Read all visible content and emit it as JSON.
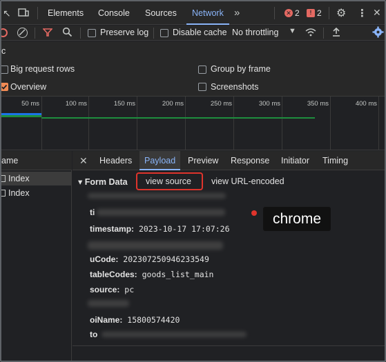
{
  "tabs": [
    {
      "label": "Elements",
      "active": false
    },
    {
      "label": "Console",
      "active": false
    },
    {
      "label": "Sources",
      "active": false
    },
    {
      "label": "Network",
      "active": true
    }
  ],
  "tab_overflow_icon": "double-chevron-right-icon",
  "errors_count": "2",
  "warnings_count": "2",
  "toolbar": {
    "preserve_log": "Preserve log",
    "disable_cache": "Disable cache",
    "throttling": "No throttling"
  },
  "settings": {
    "left_cut_label": "c",
    "big_request_rows": "Big request rows",
    "group_by_frame": "Group by frame",
    "overview": "Overview",
    "screenshots": "Screenshots",
    "overview_checked": true
  },
  "timeline": {
    "ticks": [
      "50 ms",
      "100 ms",
      "150 ms",
      "200 ms",
      "250 ms",
      "300 ms",
      "350 ms",
      "400 ms"
    ]
  },
  "request_list": {
    "header": "ame",
    "rows": [
      "Index",
      "Index"
    ]
  },
  "detail_tabs": [
    {
      "label": "Headers",
      "active": false
    },
    {
      "label": "Payload",
      "active": true
    },
    {
      "label": "Preview",
      "active": false
    },
    {
      "label": "Response",
      "active": false
    },
    {
      "label": "Initiator",
      "active": false
    },
    {
      "label": "Timing",
      "active": false
    }
  ],
  "form_data": {
    "title": "▾ Form Data",
    "view_source": "view source",
    "view_url_encoded": "view URL-encoded",
    "fields": [
      {
        "key": "ti",
        "value": ""
      },
      {
        "key": "timestamp:",
        "value": "2023-10-17 17:07:26"
      },
      {
        "key": "uCode:",
        "value": "202307250946233549"
      },
      {
        "key": "tableCodes:",
        "value": "goods_list_main"
      },
      {
        "key": "source:",
        "value": "pc"
      },
      {
        "key": "oiName:",
        "value": "15800574420"
      },
      {
        "key": "to",
        "value": ""
      }
    ]
  },
  "tooltip": "chrome",
  "colors": {
    "accent": "#8ab4f8",
    "highlight": "#e0342c",
    "checkbox": "#f28b54"
  }
}
